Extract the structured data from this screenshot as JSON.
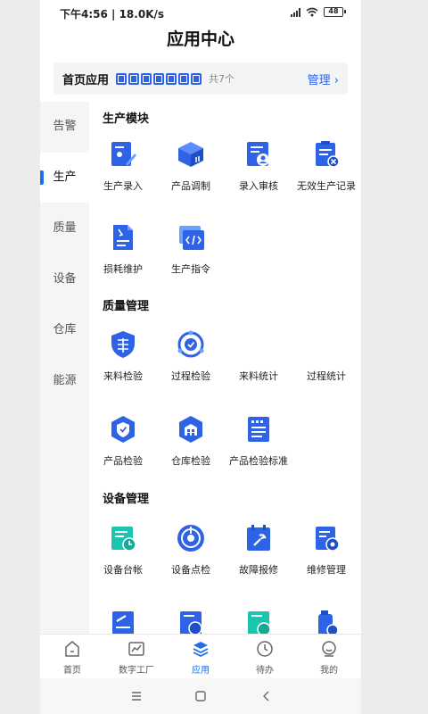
{
  "status_bar": {
    "time_speed": "下午4:56 | 18.0K/s",
    "signal": "4G",
    "battery": "48"
  },
  "header": {
    "title": "应用中心"
  },
  "home_apps": {
    "label": "首页应用",
    "count": "共7个",
    "manage": "管理 ›"
  },
  "sidebar": {
    "items": [
      "告警",
      "生产",
      "质量",
      "设备",
      "仓库",
      "能源"
    ],
    "active": "生产"
  },
  "sections": [
    {
      "title": "生产模块",
      "apps": [
        "生产录入",
        "产品调制",
        "录入审核",
        "无效生产记录",
        "损耗维护",
        "生产指令"
      ]
    },
    {
      "title": "质量管理",
      "apps": [
        "来料检验",
        "过程检验",
        "来料统计",
        "过程统计",
        "产品检验",
        "仓库检验",
        "产品检验标准"
      ]
    },
    {
      "title": "设备管理",
      "apps": [
        "设备台帐",
        "设备点检",
        "故障报修",
        "维修管理"
      ]
    }
  ],
  "tabbar": {
    "items": [
      "首页",
      "数字工厂",
      "应用",
      "待办",
      "我的"
    ],
    "active": "应用"
  },
  "colors": {
    "accent": "#1f6fe5",
    "icon_blue": "#2f63e6",
    "icon_teal": "#1bc4b0"
  }
}
